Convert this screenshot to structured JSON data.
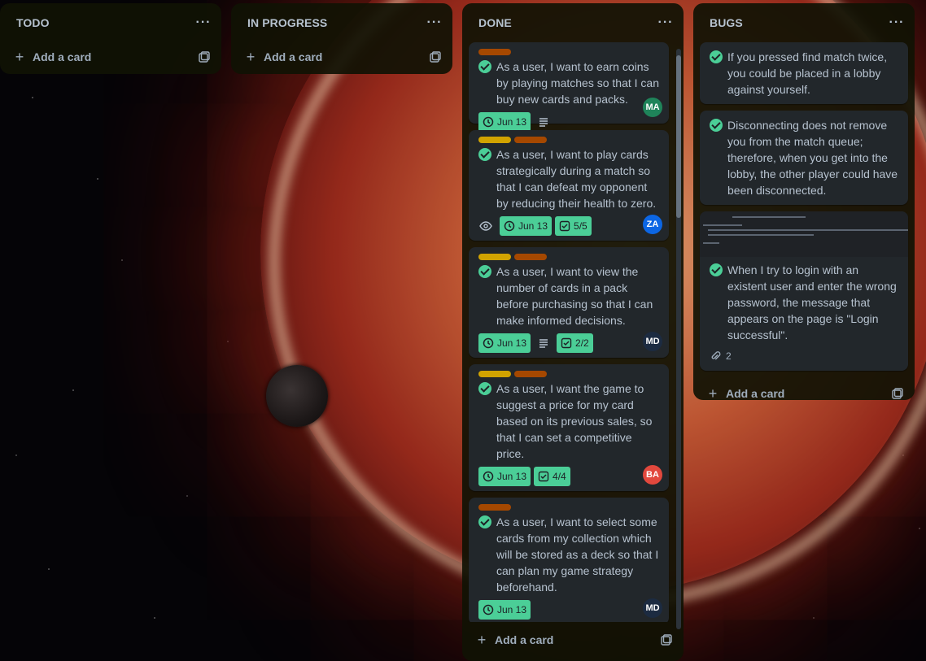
{
  "board": {
    "lists": [
      {
        "title": "TODO",
        "add_card": "Add a card"
      },
      {
        "title": "IN PROGRESS",
        "add_card": "Add a card"
      },
      {
        "title": "DONE",
        "add_card": "Add a card"
      },
      {
        "title": "BUGS",
        "add_card": "Add a card"
      }
    ],
    "more_label": "···"
  },
  "done_cards": [
    {
      "title": "As a user, I want to earn coins by playing matches so that I can buy new cards and packs.",
      "date": "Jun 13",
      "avatar": "MA",
      "avatar_color": "#1f845a"
    },
    {
      "title": "As a user, I want to play cards strategically during a match so that I can defeat my opponent by reducing their health to zero.",
      "date": "Jun 13",
      "checklist": "5/5",
      "avatar": "ZA",
      "avatar_color": "#0c66e4"
    },
    {
      "title": "As a user, I want to view the number of cards in a pack before purchasing so that I can make informed decisions.",
      "date": "Jun 13",
      "checklist": "2/2",
      "avatar": "MD",
      "avatar_color": "#1c2b41"
    },
    {
      "title": "As a user, I want the game to suggest a price for my card based on its previous sales, so that I can set a competitive price.",
      "date": "Jun 13",
      "checklist": "4/4",
      "avatar": "BA",
      "avatar_color": "#e2483d"
    },
    {
      "title": "As a user, I want to select some cards from my collection which will be stored as a deck so that I can plan my game strategy beforehand.",
      "date": "Jun 13",
      "avatar": "MD",
      "avatar_color": "#1c2b41"
    }
  ],
  "bug_cards": [
    {
      "title": "If you pressed find match twice, you could be placed in a lobby against yourself."
    },
    {
      "title": "Disconnecting does not remove you from the match queue; therefore, when you get into the lobby, the other player could have been disconnected."
    },
    {
      "title": "When I try to login with an existent user and enter the wrong password, the message that appears on the page is \"Login successful\".",
      "attachments": "2"
    }
  ],
  "colors": {
    "list_bg": "#101204",
    "card_bg": "#22272b",
    "complete_green": "#4bce97",
    "label_orange": "#a54800",
    "label_yellow": "#d1a300"
  }
}
